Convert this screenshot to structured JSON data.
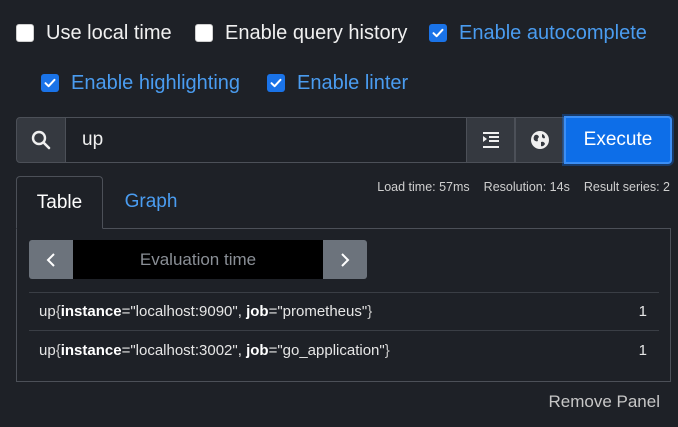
{
  "options": {
    "use_local_time": {
      "label": "Use local time",
      "checked": false
    },
    "enable_query_history": {
      "label": "Enable query history",
      "checked": false
    },
    "enable_autocomplete": {
      "label": "Enable autocomplete",
      "checked": true
    },
    "enable_highlighting": {
      "label": "Enable highlighting",
      "checked": true
    },
    "enable_linter": {
      "label": "Enable linter",
      "checked": true
    }
  },
  "search": {
    "value": "up",
    "execute_label": "Execute"
  },
  "stats": {
    "load_time": "Load time: 57ms",
    "resolution": "Resolution: 14s",
    "result_series": "Result series: 2"
  },
  "tabs": {
    "table": "Table",
    "graph": "Graph"
  },
  "eval": {
    "placeholder": "Evaluation time"
  },
  "results": [
    {
      "metric": "up",
      "labels": [
        {
          "key": "instance",
          "value": "\"localhost:9090\""
        },
        {
          "key": "job",
          "value": "\"prometheus\""
        }
      ],
      "value": "1"
    },
    {
      "metric": "up",
      "labels": [
        {
          "key": "instance",
          "value": "\"localhost:3002\""
        },
        {
          "key": "job",
          "value": "\"go_application\""
        }
      ],
      "value": "1"
    }
  ],
  "punct": {
    "open": "{",
    "close": "}",
    "eq": "=",
    "sep": ", "
  },
  "remove_panel": "Remove Panel",
  "colors": {
    "background": "#1e2127",
    "accent": "#1a73e8",
    "link": "#4a9cf0",
    "execute": "#0d6ee8"
  }
}
